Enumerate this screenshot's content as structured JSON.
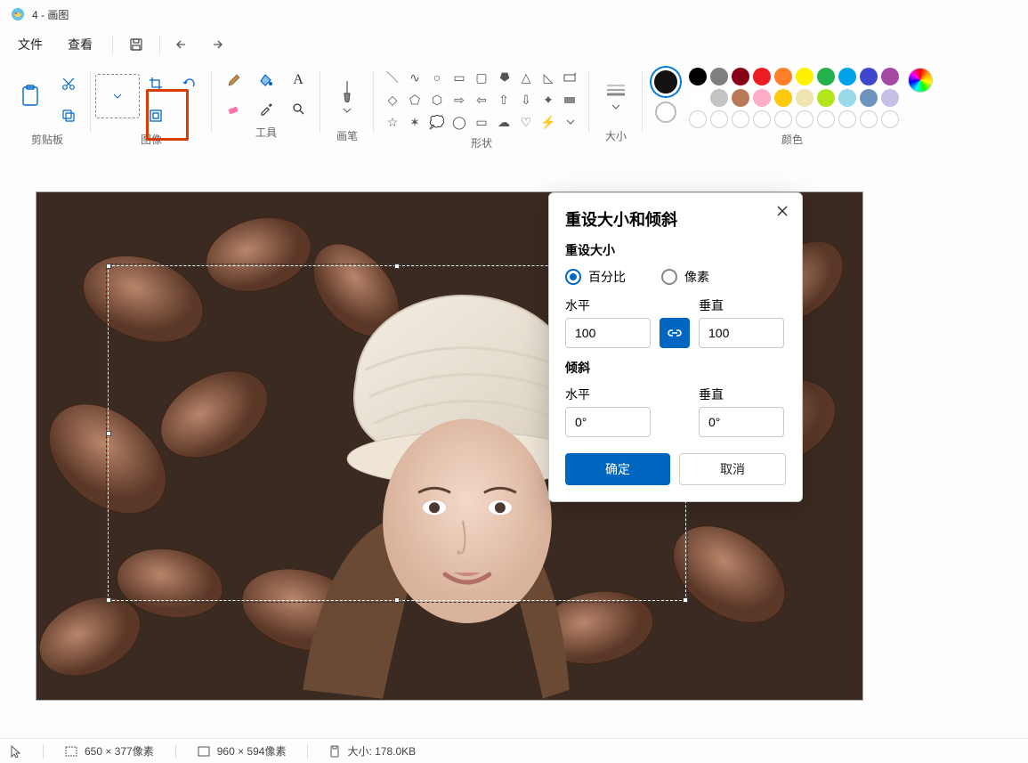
{
  "titlebar": {
    "title": "4 - 画图"
  },
  "menu": {
    "file": "文件",
    "view": "查看"
  },
  "ribbon": {
    "clipboard": "剪贴板",
    "image": "图像",
    "tools": "工具",
    "brushes": "画笔",
    "shapes": "形状",
    "size": "大小",
    "colors": "颜色"
  },
  "palette_row1": [
    "#000000",
    "#7f7f7f",
    "#880015",
    "#ed1c24",
    "#ff7f27",
    "#fff200",
    "#22b14c",
    "#00a2e8",
    "#3f48cc",
    "#a349a4"
  ],
  "palette_row2": [
    "#ffffff",
    "#c3c3c3",
    "#b97a57",
    "#ffaec9",
    "#ffc90e",
    "#efe4b0",
    "#b5e61d",
    "#99d9ea",
    "#7092be",
    "#c8bfe7"
  ],
  "dialog": {
    "title": "重设大小和倾斜",
    "resize_h": "重设大小",
    "opt_percent": "百分比",
    "opt_pixels": "像素",
    "horizontal": "水平",
    "vertical": "垂直",
    "h_val": "100",
    "v_val": "100",
    "skew_h": "倾斜",
    "skew_hv": "0°",
    "skew_vv": "0°",
    "ok": "确定",
    "cancel": "取消"
  },
  "status": {
    "selection": "650 × 377像素",
    "canvas": "960 × 594像素",
    "filesize": "大小: 178.0KB"
  }
}
